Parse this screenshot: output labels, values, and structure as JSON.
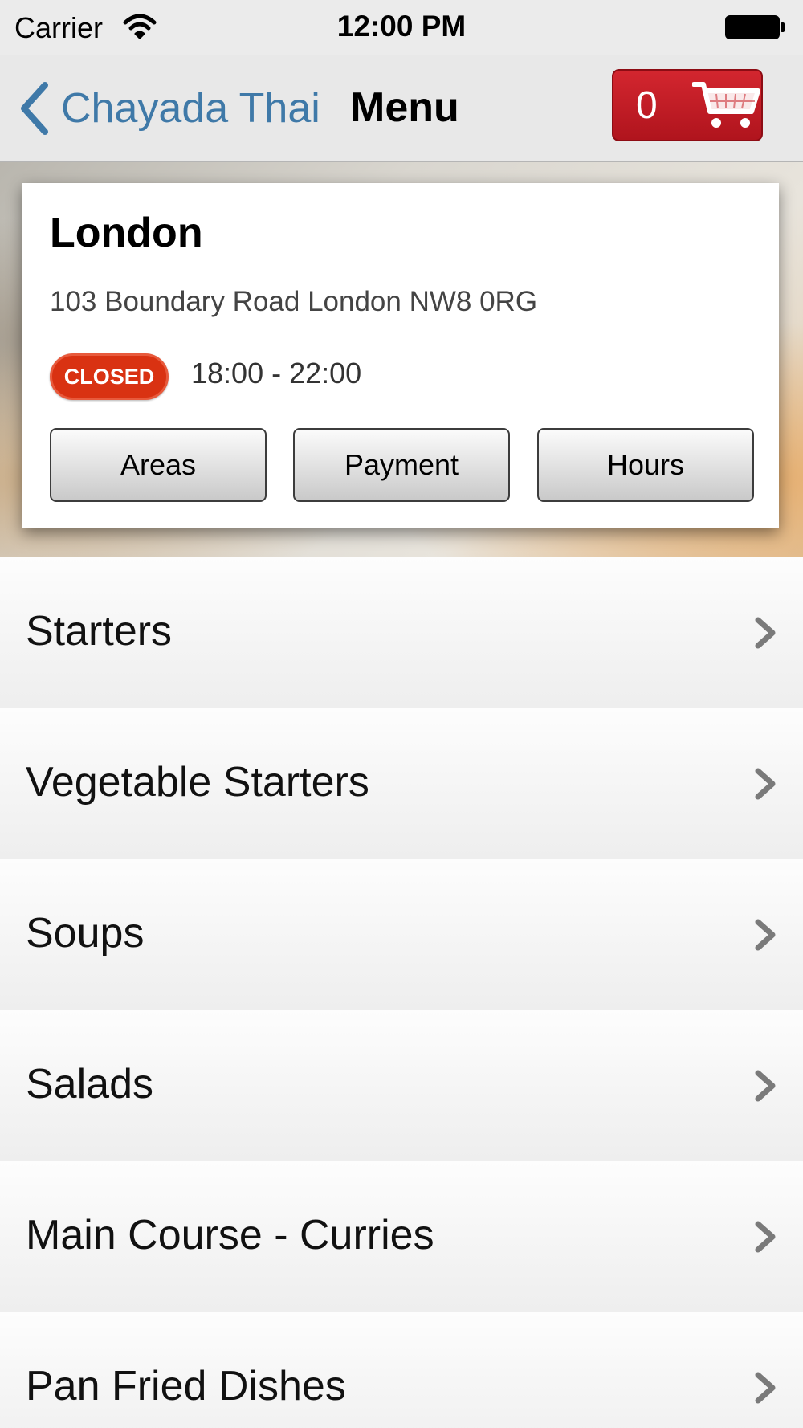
{
  "status_bar": {
    "carrier": "Carrier",
    "time": "12:00 PM",
    "wifi_icon": "wifi-icon",
    "battery_icon": "battery-icon"
  },
  "nav": {
    "back_label": "Chayada Thai",
    "back_icon": "chevron-left-icon",
    "title": "Menu",
    "cart_count": "0",
    "cart_icon": "shopping-cart-icon",
    "accent_color": "#3f79a8",
    "cart_color": "#c01c24"
  },
  "location": {
    "city": "London",
    "address": "103 Boundary Road London NW8 0RG",
    "status": "CLOSED",
    "status_color": "#d93212",
    "hours": "18:00 - 22:00",
    "buttons": {
      "areas": "Areas",
      "payment": "Payment",
      "hours": "Hours"
    }
  },
  "categories": [
    {
      "label": "Starters"
    },
    {
      "label": "Vegetable Starters"
    },
    {
      "label": "Soups"
    },
    {
      "label": "Salads"
    },
    {
      "label": "Main Course - Curries"
    },
    {
      "label": "Pan Fried Dishes"
    }
  ]
}
